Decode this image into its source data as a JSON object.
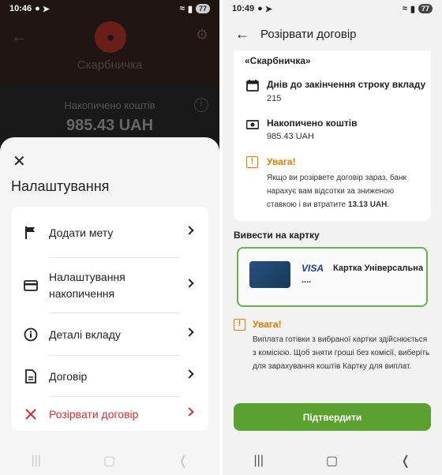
{
  "left": {
    "status": {
      "time": "10:46",
      "battery": "77"
    },
    "background": {
      "title": "Скарбничка",
      "accumulated_label": "Накопичено коштів",
      "accumulated_value": "985.43 UAH"
    },
    "sheet": {
      "title": "Налаштування",
      "items": [
        {
          "label": "Додати мету",
          "icon": "flag-icon"
        },
        {
          "label": "Налаштування накопичення",
          "icon": "card-icon"
        },
        {
          "label": "Деталі вкладу",
          "icon": "info-icon"
        },
        {
          "label": "Договір",
          "icon": "document-icon"
        },
        {
          "label": "Розірвати договір",
          "icon": "close-icon"
        }
      ]
    }
  },
  "right": {
    "status": {
      "time": "10:49",
      "battery": "77"
    },
    "header": {
      "title": "Розірвати договір"
    },
    "product_name": "«Скарбничка»",
    "days_label": "Днів до закінчення строку вкладу",
    "days_value": "215",
    "accumulated_label": "Накопичено коштів",
    "accumulated_value": "985.43 UAH",
    "warning1": {
      "title": "Увага!",
      "text_before": "Якщо ви розірвете договір зараз, банк нарахує вам відсотки за зниженою ставкою і ви втратите ",
      "amount": "13.13 UAH",
      "text_after": "."
    },
    "withdraw_section": "Вивести на картку",
    "card": {
      "brand": "VISA",
      "name": "Картка Універсальна",
      "masked": "...."
    },
    "warning2": {
      "title": "Увага!",
      "text": "Виплата готівки з вибраної картки здійснюється з комісією. Щоб зняти гроші без комісії, виберіть для зарахування коштів Картку для виплат."
    },
    "confirm_label": "Підтвердити"
  },
  "colors": {
    "accent_green": "#5aa130",
    "warning_orange": "#e07b00",
    "danger_red": "#d32f2f"
  }
}
